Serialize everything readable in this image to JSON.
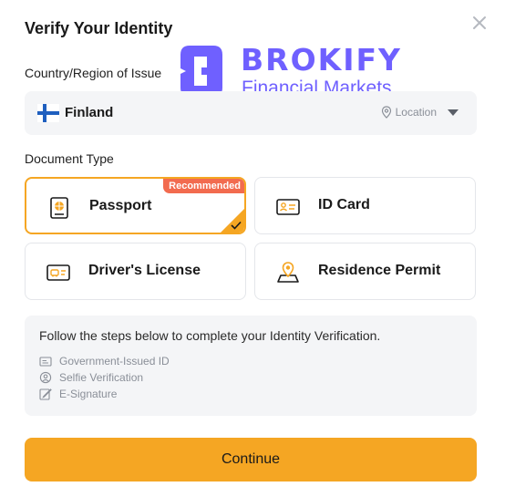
{
  "dialog": {
    "title": "Verify Your Identity"
  },
  "brand": {
    "name": "BROKIFY",
    "tagline": "Financial Markets",
    "color": "#6f60ff"
  },
  "country": {
    "label": "Country/Region of Issue",
    "value": "Finland",
    "location_label": "Location"
  },
  "document_type": {
    "label": "Document Type",
    "options": [
      {
        "name": "Passport",
        "icon": "passport-icon",
        "selected": true,
        "badge": "Recommended"
      },
      {
        "name": "ID Card",
        "icon": "id-card-icon",
        "selected": false
      },
      {
        "name": "Driver's License",
        "icon": "drivers-license-icon",
        "selected": false
      },
      {
        "name": "Residence Permit",
        "icon": "residence-permit-icon",
        "selected": false
      }
    ]
  },
  "steps": {
    "intro": "Follow the steps below to complete your Identity Verification.",
    "items": [
      {
        "label": "Government-Issued ID",
        "icon": "id-icon"
      },
      {
        "label": "Selfie Verification",
        "icon": "selfie-icon"
      },
      {
        "label": "E-Signature",
        "icon": "signature-icon"
      }
    ]
  },
  "actions": {
    "continue_label": "Continue"
  },
  "colors": {
    "accent": "#f5a623",
    "badge": "#f26b4f",
    "panel": "#f4f5f7"
  }
}
